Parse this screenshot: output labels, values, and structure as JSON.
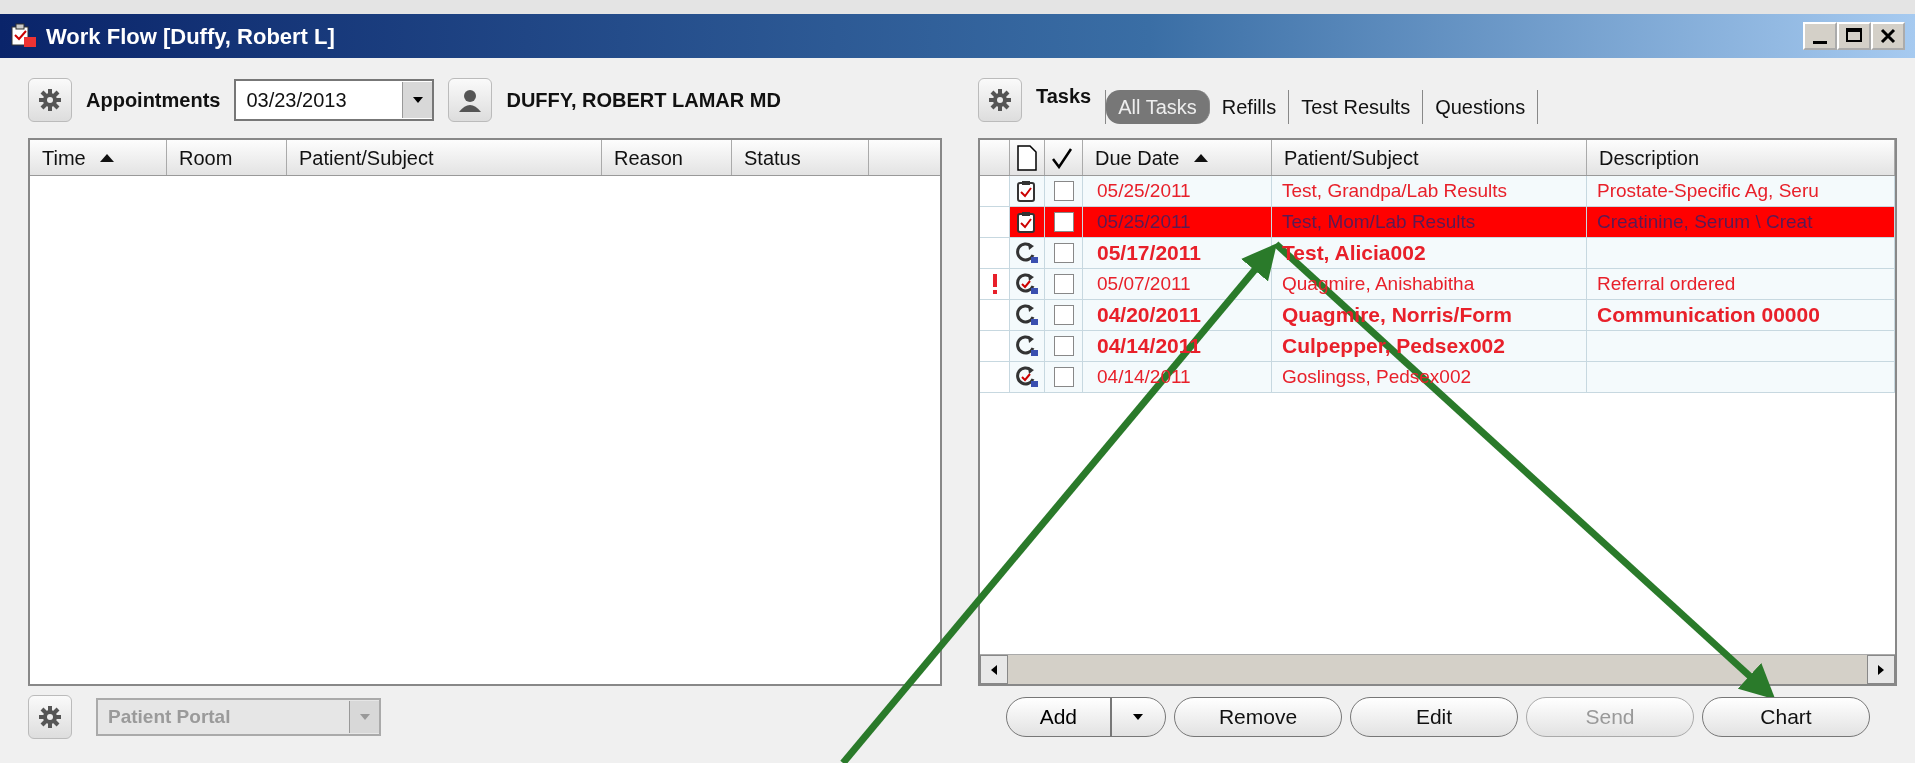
{
  "window": {
    "title": "Work Flow [Duffy, Robert L]"
  },
  "appointments": {
    "label": "Appointments",
    "date": "03/23/2013",
    "provider": "DUFFY, ROBERT LAMAR MD",
    "columns": [
      {
        "label": "Time",
        "sorted": true
      },
      {
        "label": "Room",
        "sorted": false
      },
      {
        "label": "Patient/Subject",
        "sorted": false
      },
      {
        "label": "Reason",
        "sorted": false
      },
      {
        "label": "Status",
        "sorted": false
      }
    ]
  },
  "portal": {
    "value": "Patient Portal",
    "disabled": true
  },
  "tasks": {
    "label": "Tasks",
    "tabs": [
      {
        "label": "All Tasks",
        "selected": true
      },
      {
        "label": "Refills",
        "selected": false
      },
      {
        "label": "Test Results",
        "selected": false
      },
      {
        "label": "Questions",
        "selected": false
      }
    ],
    "columns": [
      {
        "label": "Due Date",
        "sorted": true
      },
      {
        "label": "Patient/Subject",
        "sorted": false
      },
      {
        "label": "Description",
        "sorted": false
      }
    ],
    "rows": [
      {
        "kind": "result",
        "flag": false,
        "bold": false,
        "selected": false,
        "checked": false,
        "due": "05/25/2011",
        "patient": "Test, Grandpa/Lab Results",
        "description": "Prostate-Specific Ag, Seru"
      },
      {
        "kind": "result",
        "flag": false,
        "bold": false,
        "selected": true,
        "checked": false,
        "due": "05/25/2011",
        "patient": "Test, Mom/Lab Results",
        "description": "Creatinine, Serum \\ Creat"
      },
      {
        "kind": "followup",
        "flag": false,
        "bold": true,
        "selected": false,
        "checked": false,
        "due": "05/17/2011",
        "patient": "Test, Alicia002"
      },
      {
        "kind": "referral",
        "flag": true,
        "bold": false,
        "selected": false,
        "checked": false,
        "due": "05/07/2011",
        "patient": "Quagmire, Anishabitha",
        "description": "Referral ordered"
      },
      {
        "kind": "followup",
        "flag": false,
        "bold": true,
        "selected": false,
        "checked": false,
        "due": "04/20/2011",
        "patient": "Quagmire, Norris/Form",
        "description": "Communication 00000"
      },
      {
        "kind": "followup",
        "flag": false,
        "bold": true,
        "selected": false,
        "checked": false,
        "due": "04/14/2011",
        "patient": "Culpepper, Pedsex002"
      },
      {
        "kind": "referral",
        "flag": false,
        "bold": false,
        "selected": false,
        "checked": false,
        "due": "04/14/2011",
        "patient": "Goslingss, Pedsex002"
      }
    ]
  },
  "buttons": [
    {
      "label": "Add",
      "disabled": false,
      "dropdown": true
    },
    {
      "label": "Remove",
      "disabled": false,
      "dropdown": false
    },
    {
      "label": "Edit",
      "disabled": false,
      "dropdown": false
    },
    {
      "label": "Send",
      "disabled": true,
      "dropdown": false
    },
    {
      "label": "Chart",
      "disabled": false,
      "dropdown": false
    }
  ]
}
